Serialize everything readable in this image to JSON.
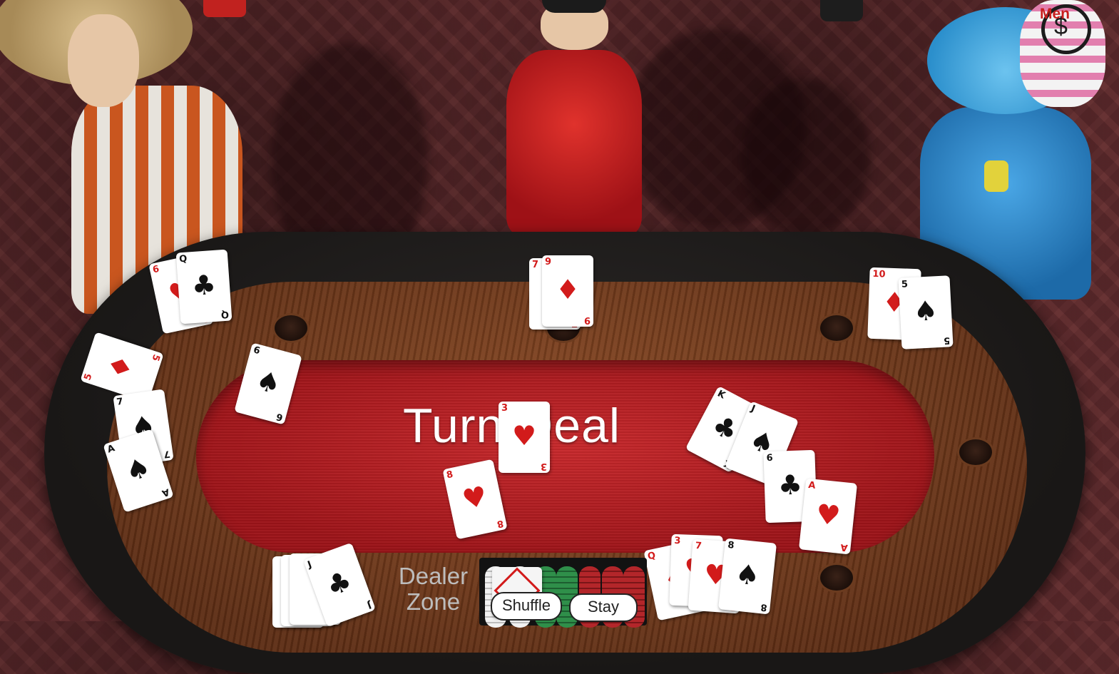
{
  "table": {
    "banner_text": "Turn Deal"
  },
  "dealer": {
    "zone_label_line1": "Dealer",
    "zone_label_line2": "Zone",
    "buttons": {
      "shuffle": "Shuffle",
      "stay": "Stay"
    }
  },
  "menu": {
    "label": "Men",
    "icon": "dollar-dial-icon"
  },
  "cards": {
    "player_left_top": [
      {
        "rank": "6",
        "suit": "♥",
        "color": "red"
      },
      {
        "rank": "Q",
        "suit": "♣",
        "color": "blk"
      }
    ],
    "player_center": [
      {
        "rank": "7",
        "suit": "♦",
        "color": "red"
      },
      {
        "rank": "9",
        "suit": "♦",
        "color": "red"
      }
    ],
    "player_right": [
      {
        "rank": "10",
        "suit": "♦",
        "color": "red"
      },
      {
        "rank": "5",
        "suit": "♠",
        "color": "blk"
      }
    ],
    "player_left_side": [
      {
        "rank": "5",
        "suit": "♦",
        "color": "red"
      },
      {
        "rank": "7",
        "suit": "♠",
        "color": "blk"
      },
      {
        "rank": "A",
        "suit": "♠",
        "color": "blk"
      }
    ],
    "table_loose": [
      {
        "rank": "6",
        "suit": "♠",
        "color": "blk"
      },
      {
        "rank": "3",
        "suit": "♥",
        "color": "red"
      },
      {
        "rank": "8",
        "suit": "♥",
        "color": "red"
      },
      {
        "rank": "K",
        "suit": "♣",
        "color": "blk"
      },
      {
        "rank": "J",
        "suit": "♠",
        "color": "blk"
      },
      {
        "rank": "6",
        "suit": "♣",
        "color": "blk"
      },
      {
        "rank": "A",
        "suit": "♥",
        "color": "red"
      }
    ],
    "dealer_hand": [
      {
        "rank": "J",
        "suit": "♣",
        "color": "blk"
      }
    ],
    "bottom_right_hand": [
      {
        "rank": "Q",
        "suit": "♦",
        "color": "red"
      },
      {
        "rank": "3",
        "suit": "♥",
        "color": "red"
      },
      {
        "rank": "7",
        "suit": "♥",
        "color": "red"
      },
      {
        "rank": "8",
        "suit": "♠",
        "color": "blk"
      }
    ]
  },
  "colors": {
    "felt": "#c8292c",
    "rail": "#1c1a19",
    "wood": "#7a4020",
    "card_red": "#d21b1b",
    "chip_white": "#f2f2f2",
    "chip_green": "#2f8f4a",
    "chip_red": "#b3262a"
  }
}
